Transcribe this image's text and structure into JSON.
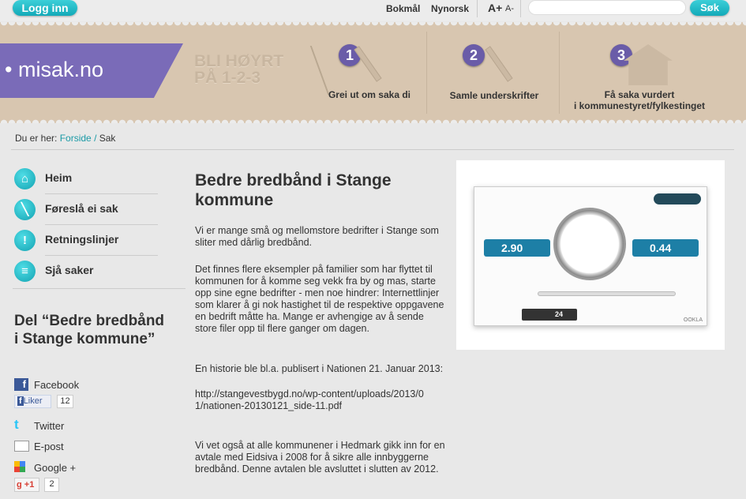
{
  "topbar": {
    "login": "Logg inn",
    "bokmal": "Bokmål",
    "nynorsk": "Nynorsk",
    "font_up": "A+",
    "font_down": "A-",
    "search_placeholder": "",
    "search_button": "Søk"
  },
  "banner": {
    "logo": "misak.no",
    "slogan_line1": "BLI HØYRT",
    "slogan_line2": "PÅ 1-2-3",
    "steps": [
      {
        "num": "1",
        "label": "Grei ut om saka di",
        "icon": "pen-icon"
      },
      {
        "num": "2",
        "label": "Samle underskrifter",
        "icon": "signature-pen-icon"
      },
      {
        "num": "3",
        "label_line1": "Få saka vurdert",
        "label_line2": "i kommunestyret/fylkestinget",
        "icon": "building-icon"
      }
    ]
  },
  "breadcrumb": {
    "prefix": "Du er her:",
    "home": "Forside",
    "sep": "/",
    "current": "Sak"
  },
  "nav": [
    {
      "label": "Heim",
      "icon": "home-icon"
    },
    {
      "label": "Føreslå ei sak",
      "icon": "pen-icon"
    },
    {
      "label": "Retningslinjer",
      "icon": "exclamation-icon"
    },
    {
      "label": "Sjå saker",
      "icon": "list-icon"
    }
  ],
  "share": {
    "title": "Del “Bedre bredbånd i Stange kommune”",
    "facebook": "Facebook",
    "like": "Liker",
    "like_count": "12",
    "twitter": "Twitter",
    "email": "E-post",
    "google": "Google +",
    "plusone": "+1",
    "plusone_count": "2"
  },
  "article": {
    "title": "Bedre bredbånd i Stange kommune",
    "paragraphs": [
      "Vi er mange små og mellomstore bedrifter i Stange som sliter med dårlig bredbånd.",
      "Det finnes flere eksempler på familier som har flyttet til kommunen for å komme seg vekk fra by og mas, starte opp sine egne bedrifter - men noe hindrer: Internettlinjer som klarer å gi nok hastighet til de respektive oppgavene en bedrift måtte ha. Mange er avhengige av å sende store filer opp til flere ganger om dagen.",
      "En historie ble bl.a. publisert i Nationen 21. Januar 2013:",
      "http://stangevestbygd.no/wp-content/uploads/2013/01/nationen-20130121_side-11.pdf",
      "Vi vet også at alle kommunener i Hedmark gikk inn for en avtale med Eidsiva i 2008 for å sikre alle innbyggerne bredbånd. Denne avtalen ble avsluttet i slutten av 2012."
    ]
  },
  "speedtest": {
    "download": "2.90",
    "upload": "0.44",
    "ping": "24",
    "brand": "OOKLA"
  },
  "colors": {
    "accent": "#1aaebc",
    "logo": "#7a6bb8",
    "banner": "#d8c6b0"
  }
}
